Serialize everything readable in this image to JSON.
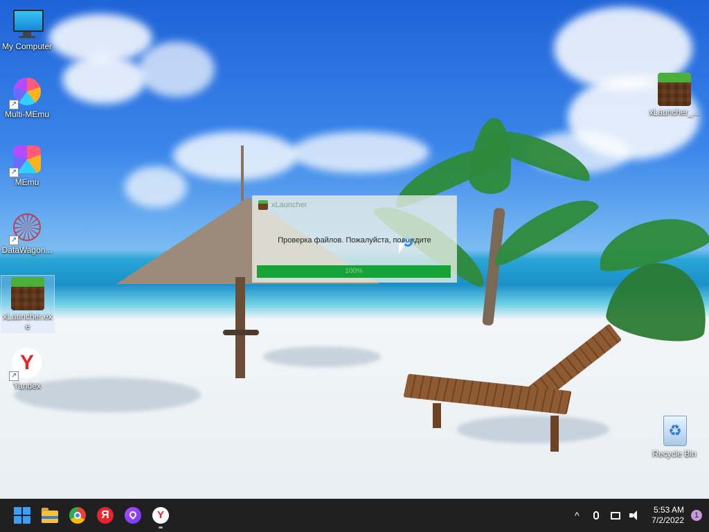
{
  "desktop": {
    "icons_left": [
      {
        "label": "My Computer"
      },
      {
        "label": "Multi-MEmu"
      },
      {
        "label": "MEmu"
      },
      {
        "label": "DataWagon..."
      },
      {
        "label": "xLauncher.exe"
      },
      {
        "label": "Yandex"
      }
    ],
    "icons_right": [
      {
        "label": "xLauncher_..."
      },
      {
        "label": "Recycle Bin"
      }
    ]
  },
  "launcher": {
    "title": "xLauncher",
    "message": "Проверка файлов. Пожалуйста, подождите",
    "progress_text": "100%",
    "progress": 1.0,
    "colors": {
      "progress_fill": "#17a238"
    }
  },
  "taskbar": {
    "pinned": [
      {
        "icon": "start-icon"
      },
      {
        "icon": "file-explorer-icon"
      },
      {
        "icon": "chrome-icon"
      },
      {
        "icon": "yandex-icon",
        "glyph": "Я"
      },
      {
        "icon": "alice-icon"
      },
      {
        "icon": "yandex-browser-icon",
        "glyph": "Y",
        "active": true
      }
    ],
    "tray": {
      "time": "5:53 AM",
      "date": "7/2/2022",
      "notification_count": "1",
      "chevron": "^"
    }
  },
  "colors": {
    "taskbar_bg": "#202020",
    "accent": "#3aa0ff"
  }
}
